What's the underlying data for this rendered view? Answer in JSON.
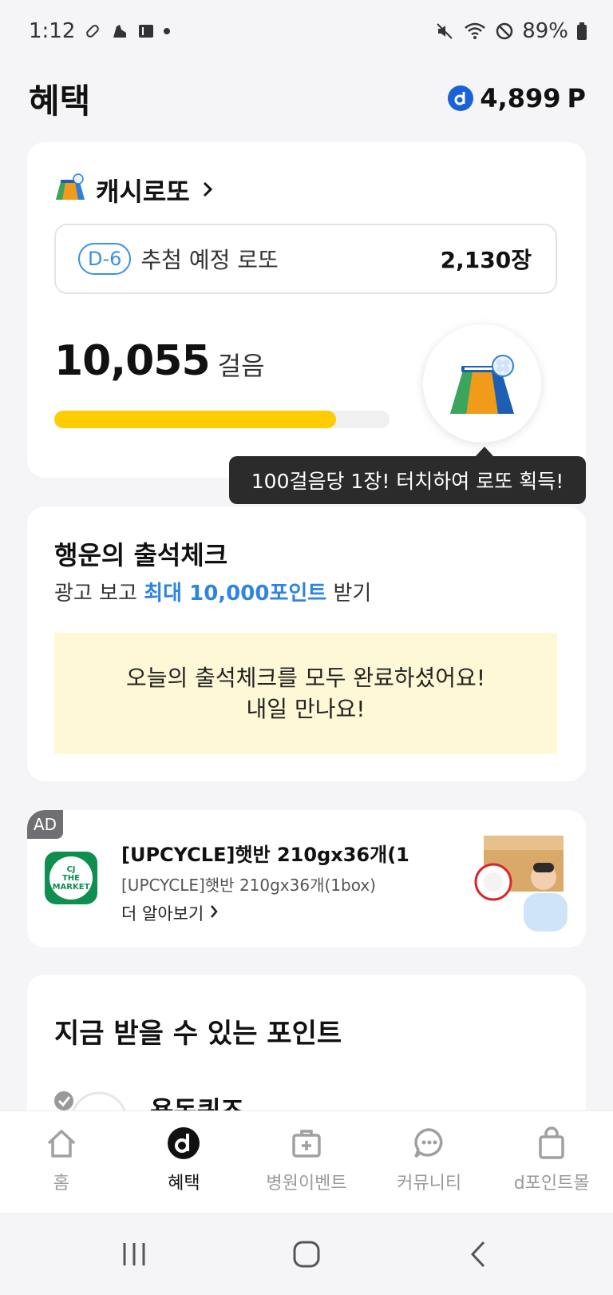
{
  "status_bar": {
    "time": "1:12",
    "battery": "89%"
  },
  "header": {
    "title": "혜택",
    "points": "4,899",
    "points_unit": "P"
  },
  "lotto": {
    "title": "캐시로또",
    "dday": "D-6",
    "scheduled_label": "추첨 예정 로또",
    "count": "2,130장",
    "steps": "10,055",
    "steps_unit": "걸음",
    "progress": 0.84,
    "tooltip": "100걸음당 1장! 터치하여 로또 획득!"
  },
  "attendance": {
    "title": "행운의 출석체크",
    "sub_prefix": "광고 보고 ",
    "sub_highlight": "최대 10,000포인트",
    "sub_suffix": " 받기",
    "done_line1": "오늘의 출석체크를 모두 완료하셨어요!",
    "done_line2": "내일 만나요!"
  },
  "ad": {
    "badge": "AD",
    "logo_line1": "CJ",
    "logo_line2": "THE",
    "logo_line3": "MARKET",
    "title": "[UPCYCLE]햇반 210gx36개(1...",
    "description": "[UPCYCLE]햇반 210gx36개(1box)",
    "more": "더 알아보기"
  },
  "points_section": {
    "title": "지금 받을 수 있는 포인트",
    "first_item": "용돈퀴즈"
  },
  "nav": [
    {
      "label": "홈",
      "icon": "home-icon"
    },
    {
      "label": "혜택",
      "icon": "d-logo-icon"
    },
    {
      "label": "병원이벤트",
      "icon": "medical-bag-icon"
    },
    {
      "label": "커뮤니티",
      "icon": "chat-bubble-icon"
    },
    {
      "label": "d포인트몰",
      "icon": "shopping-bag-icon"
    }
  ],
  "colors": {
    "accent_blue": "#2f84e0",
    "progress_yellow": "#ffcc00",
    "notice_bg": "#fff8d6"
  }
}
